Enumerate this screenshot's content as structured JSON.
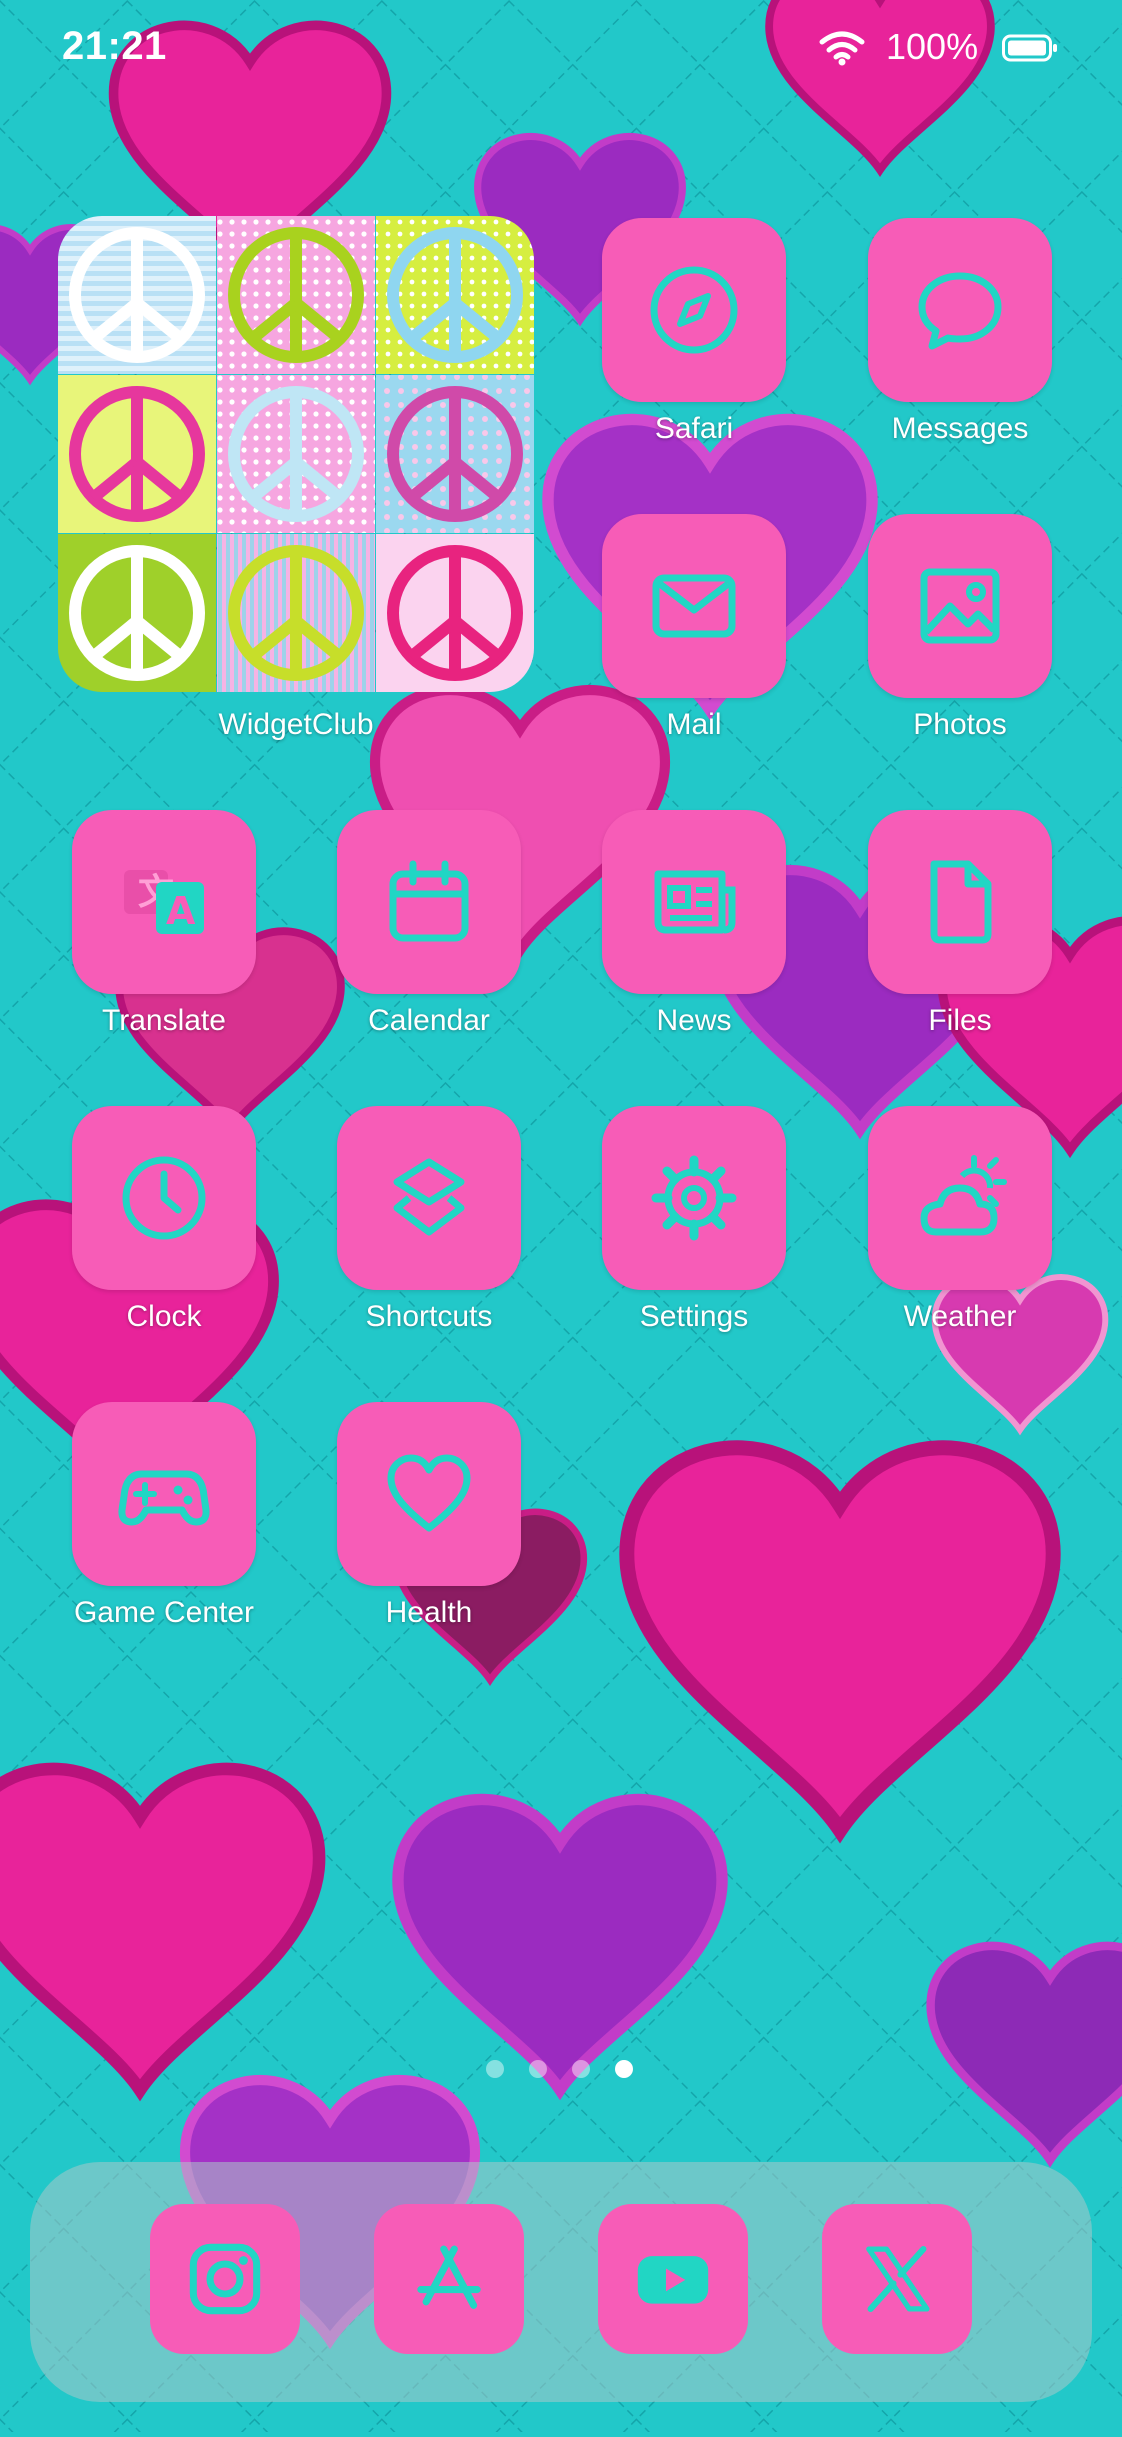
{
  "status_bar": {
    "time": "21:21",
    "battery_percent": "100%",
    "wifi_icon": "wifi-icon",
    "battery_icon": "battery-full-icon"
  },
  "widget": {
    "label": "WidgetClub",
    "content": "peace-sign-collage"
  },
  "apps": [
    {
      "label": "Safari",
      "icon": "compass-icon"
    },
    {
      "label": "Messages",
      "icon": "chat-bubble-icon"
    },
    {
      "label": "Mail",
      "icon": "envelope-icon"
    },
    {
      "label": "Photos",
      "icon": "photo-icon"
    },
    {
      "label": "Translate",
      "icon": "translate-icon"
    },
    {
      "label": "Calendar",
      "icon": "calendar-icon"
    },
    {
      "label": "News",
      "icon": "newspaper-icon"
    },
    {
      "label": "Files",
      "icon": "file-icon"
    },
    {
      "label": "Clock",
      "icon": "clock-icon"
    },
    {
      "label": "Shortcuts",
      "icon": "layers-icon"
    },
    {
      "label": "Settings",
      "icon": "gear-icon"
    },
    {
      "label": "Weather",
      "icon": "sun-cloud-icon"
    },
    {
      "label": "Game Center",
      "icon": "gamepad-icon"
    },
    {
      "label": "Health",
      "icon": "heart-icon"
    }
  ],
  "page_indicator": {
    "pages": 4,
    "current_page": 4
  },
  "dock": [
    {
      "name": "Instagram",
      "icon": "instagram-icon"
    },
    {
      "name": "App Store",
      "icon": "app-store-icon"
    },
    {
      "name": "YouTube",
      "icon": "youtube-icon"
    },
    {
      "name": "X",
      "icon": "x-logo-icon"
    }
  ],
  "colors": {
    "icon_background": "#f75cb7",
    "icon_glyph": "#21d6c4",
    "wallpaper_quilt": "#21c9c9",
    "hearts_pink": "#e8239a",
    "hearts_purple": "#9b2bc0",
    "label_text": "#ffffff"
  }
}
